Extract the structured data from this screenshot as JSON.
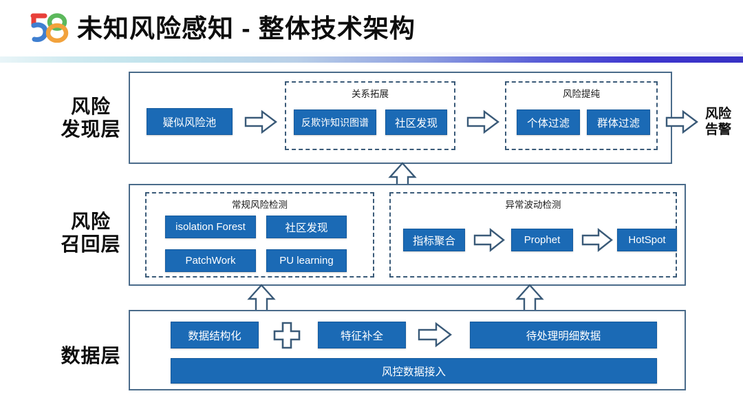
{
  "header": {
    "logo_text": "58",
    "logo_name": "58-logo-icon",
    "title": "未知风险感知 - 整体技术架构"
  },
  "colors": {
    "box_blue": "#1b6ab5",
    "border_blue": "#4a6b8a",
    "dash_border": "#3a5a78",
    "arrow_stroke": "#3a5a78",
    "text_dark": "#0d0d0d",
    "gradient_left": "#cfeaf0",
    "gradient_right": "#3731c4",
    "logo_red": "#e8403a",
    "logo_blue": "#3f7fd0",
    "logo_green": "#5cb85c",
    "logo_orange": "#f2a23c"
  },
  "layers": [
    {
      "id": "risk-discovery",
      "label": "风险\n发现层",
      "label_line1": "风险",
      "label_line2": "发现层",
      "nodes": [
        {
          "name": "suspected-risk-pool",
          "text": "疑似风险池"
        },
        {
          "name": "anti-fraud-knowledge-graph",
          "text": "反欺诈知识图谱"
        },
        {
          "name": "community-detection",
          "text": "社区发现"
        },
        {
          "name": "individual-filter",
          "text": "个体过滤"
        },
        {
          "name": "group-filter",
          "text": "群体过滤"
        }
      ],
      "groups": [
        {
          "name": "relation-expansion-group",
          "title": "关系拓展"
        },
        {
          "name": "risk-purification-group",
          "title": "风险提纯"
        }
      ],
      "output": {
        "name": "risk-alert-output",
        "line1": "风险",
        "line2": "告警"
      }
    },
    {
      "id": "risk-recall",
      "label_line1": "风险",
      "label_line2": "召回层",
      "groups": [
        {
          "name": "routine-risk-detection-group",
          "title": "常规风险检测"
        },
        {
          "name": "anomaly-fluctuation-detection-group",
          "title": "异常波动检测"
        }
      ],
      "nodes": [
        {
          "name": "isolation-forest",
          "text": "isolation Forest"
        },
        {
          "name": "community-detection-recall",
          "text": "社区发现"
        },
        {
          "name": "patchwork",
          "text": "PatchWork"
        },
        {
          "name": "pu-learning",
          "text": "PU learning"
        },
        {
          "name": "metric-aggregation",
          "text": "指标聚合"
        },
        {
          "name": "prophet",
          "text": "Prophet"
        },
        {
          "name": "hotspot",
          "text": "HotSpot"
        }
      ]
    },
    {
      "id": "data-layer",
      "label_line1": "数据层",
      "label_line2": "",
      "nodes": [
        {
          "name": "data-structuring",
          "text": "数据结构化"
        },
        {
          "name": "feature-completion",
          "text": "特征补全"
        },
        {
          "name": "pending-detail-data",
          "text": "待处理明细数据"
        },
        {
          "name": "risk-control-data-ingest",
          "text": "风控数据接入"
        }
      ],
      "groups": []
    }
  ],
  "connectors": [
    {
      "name": "arrow-right-pool-to-relation",
      "direction": "right"
    },
    {
      "name": "arrow-right-relation-to-purification",
      "direction": "right"
    },
    {
      "name": "arrow-right-purification-to-alert",
      "direction": "right"
    },
    {
      "name": "arrow-up-recall-to-discovery",
      "direction": "up"
    },
    {
      "name": "arrow-right-metric-to-prophet",
      "direction": "right"
    },
    {
      "name": "arrow-right-prophet-to-hotspot",
      "direction": "right"
    },
    {
      "name": "arrow-up-data-to-routine",
      "direction": "up"
    },
    {
      "name": "arrow-up-data-to-anomaly",
      "direction": "up"
    },
    {
      "name": "plus-structuring-feature",
      "direction": "plus"
    },
    {
      "name": "arrow-right-feature-to-pending",
      "direction": "right"
    }
  ]
}
